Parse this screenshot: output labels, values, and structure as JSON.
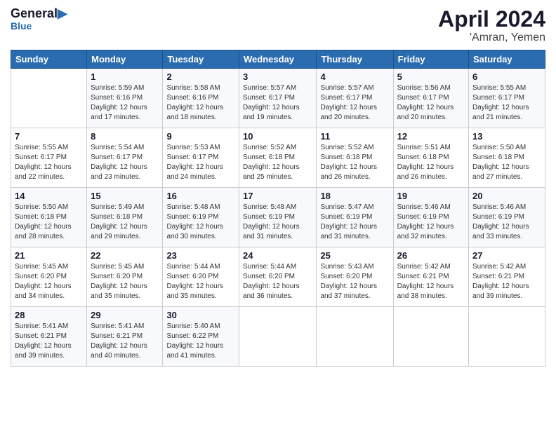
{
  "header": {
    "logo_line1": "General",
    "logo_line2": "Blue",
    "main_title": "April 2024",
    "subtitle": "'Amran, Yemen"
  },
  "days_of_week": [
    "Sunday",
    "Monday",
    "Tuesday",
    "Wednesday",
    "Thursday",
    "Friday",
    "Saturday"
  ],
  "weeks": [
    [
      {
        "day": "",
        "info": ""
      },
      {
        "day": "1",
        "info": "Sunrise: 5:59 AM\nSunset: 6:16 PM\nDaylight: 12 hours\nand 17 minutes."
      },
      {
        "day": "2",
        "info": "Sunrise: 5:58 AM\nSunset: 6:16 PM\nDaylight: 12 hours\nand 18 minutes."
      },
      {
        "day": "3",
        "info": "Sunrise: 5:57 AM\nSunset: 6:17 PM\nDaylight: 12 hours\nand 19 minutes."
      },
      {
        "day": "4",
        "info": "Sunrise: 5:57 AM\nSunset: 6:17 PM\nDaylight: 12 hours\nand 20 minutes."
      },
      {
        "day": "5",
        "info": "Sunrise: 5:56 AM\nSunset: 6:17 PM\nDaylight: 12 hours\nand 20 minutes."
      },
      {
        "day": "6",
        "info": "Sunrise: 5:55 AM\nSunset: 6:17 PM\nDaylight: 12 hours\nand 21 minutes."
      }
    ],
    [
      {
        "day": "7",
        "info": "Sunrise: 5:55 AM\nSunset: 6:17 PM\nDaylight: 12 hours\nand 22 minutes."
      },
      {
        "day": "8",
        "info": "Sunrise: 5:54 AM\nSunset: 6:17 PM\nDaylight: 12 hours\nand 23 minutes."
      },
      {
        "day": "9",
        "info": "Sunrise: 5:53 AM\nSunset: 6:17 PM\nDaylight: 12 hours\nand 24 minutes."
      },
      {
        "day": "10",
        "info": "Sunrise: 5:52 AM\nSunset: 6:18 PM\nDaylight: 12 hours\nand 25 minutes."
      },
      {
        "day": "11",
        "info": "Sunrise: 5:52 AM\nSunset: 6:18 PM\nDaylight: 12 hours\nand 26 minutes."
      },
      {
        "day": "12",
        "info": "Sunrise: 5:51 AM\nSunset: 6:18 PM\nDaylight: 12 hours\nand 26 minutes."
      },
      {
        "day": "13",
        "info": "Sunrise: 5:50 AM\nSunset: 6:18 PM\nDaylight: 12 hours\nand 27 minutes."
      }
    ],
    [
      {
        "day": "14",
        "info": "Sunrise: 5:50 AM\nSunset: 6:18 PM\nDaylight: 12 hours\nand 28 minutes."
      },
      {
        "day": "15",
        "info": "Sunrise: 5:49 AM\nSunset: 6:18 PM\nDaylight: 12 hours\nand 29 minutes."
      },
      {
        "day": "16",
        "info": "Sunrise: 5:48 AM\nSunset: 6:19 PM\nDaylight: 12 hours\nand 30 minutes."
      },
      {
        "day": "17",
        "info": "Sunrise: 5:48 AM\nSunset: 6:19 PM\nDaylight: 12 hours\nand 31 minutes."
      },
      {
        "day": "18",
        "info": "Sunrise: 5:47 AM\nSunset: 6:19 PM\nDaylight: 12 hours\nand 31 minutes."
      },
      {
        "day": "19",
        "info": "Sunrise: 5:46 AM\nSunset: 6:19 PM\nDaylight: 12 hours\nand 32 minutes."
      },
      {
        "day": "20",
        "info": "Sunrise: 5:46 AM\nSunset: 6:19 PM\nDaylight: 12 hours\nand 33 minutes."
      }
    ],
    [
      {
        "day": "21",
        "info": "Sunrise: 5:45 AM\nSunset: 6:20 PM\nDaylight: 12 hours\nand 34 minutes."
      },
      {
        "day": "22",
        "info": "Sunrise: 5:45 AM\nSunset: 6:20 PM\nDaylight: 12 hours\nand 35 minutes."
      },
      {
        "day": "23",
        "info": "Sunrise: 5:44 AM\nSunset: 6:20 PM\nDaylight: 12 hours\nand 35 minutes."
      },
      {
        "day": "24",
        "info": "Sunrise: 5:44 AM\nSunset: 6:20 PM\nDaylight: 12 hours\nand 36 minutes."
      },
      {
        "day": "25",
        "info": "Sunrise: 5:43 AM\nSunset: 6:20 PM\nDaylight: 12 hours\nand 37 minutes."
      },
      {
        "day": "26",
        "info": "Sunrise: 5:42 AM\nSunset: 6:21 PM\nDaylight: 12 hours\nand 38 minutes."
      },
      {
        "day": "27",
        "info": "Sunrise: 5:42 AM\nSunset: 6:21 PM\nDaylight: 12 hours\nand 39 minutes."
      }
    ],
    [
      {
        "day": "28",
        "info": "Sunrise: 5:41 AM\nSunset: 6:21 PM\nDaylight: 12 hours\nand 39 minutes."
      },
      {
        "day": "29",
        "info": "Sunrise: 5:41 AM\nSunset: 6:21 PM\nDaylight: 12 hours\nand 40 minutes."
      },
      {
        "day": "30",
        "info": "Sunrise: 5:40 AM\nSunset: 6:22 PM\nDaylight: 12 hours\nand 41 minutes."
      },
      {
        "day": "",
        "info": ""
      },
      {
        "day": "",
        "info": ""
      },
      {
        "day": "",
        "info": ""
      },
      {
        "day": "",
        "info": ""
      }
    ]
  ]
}
